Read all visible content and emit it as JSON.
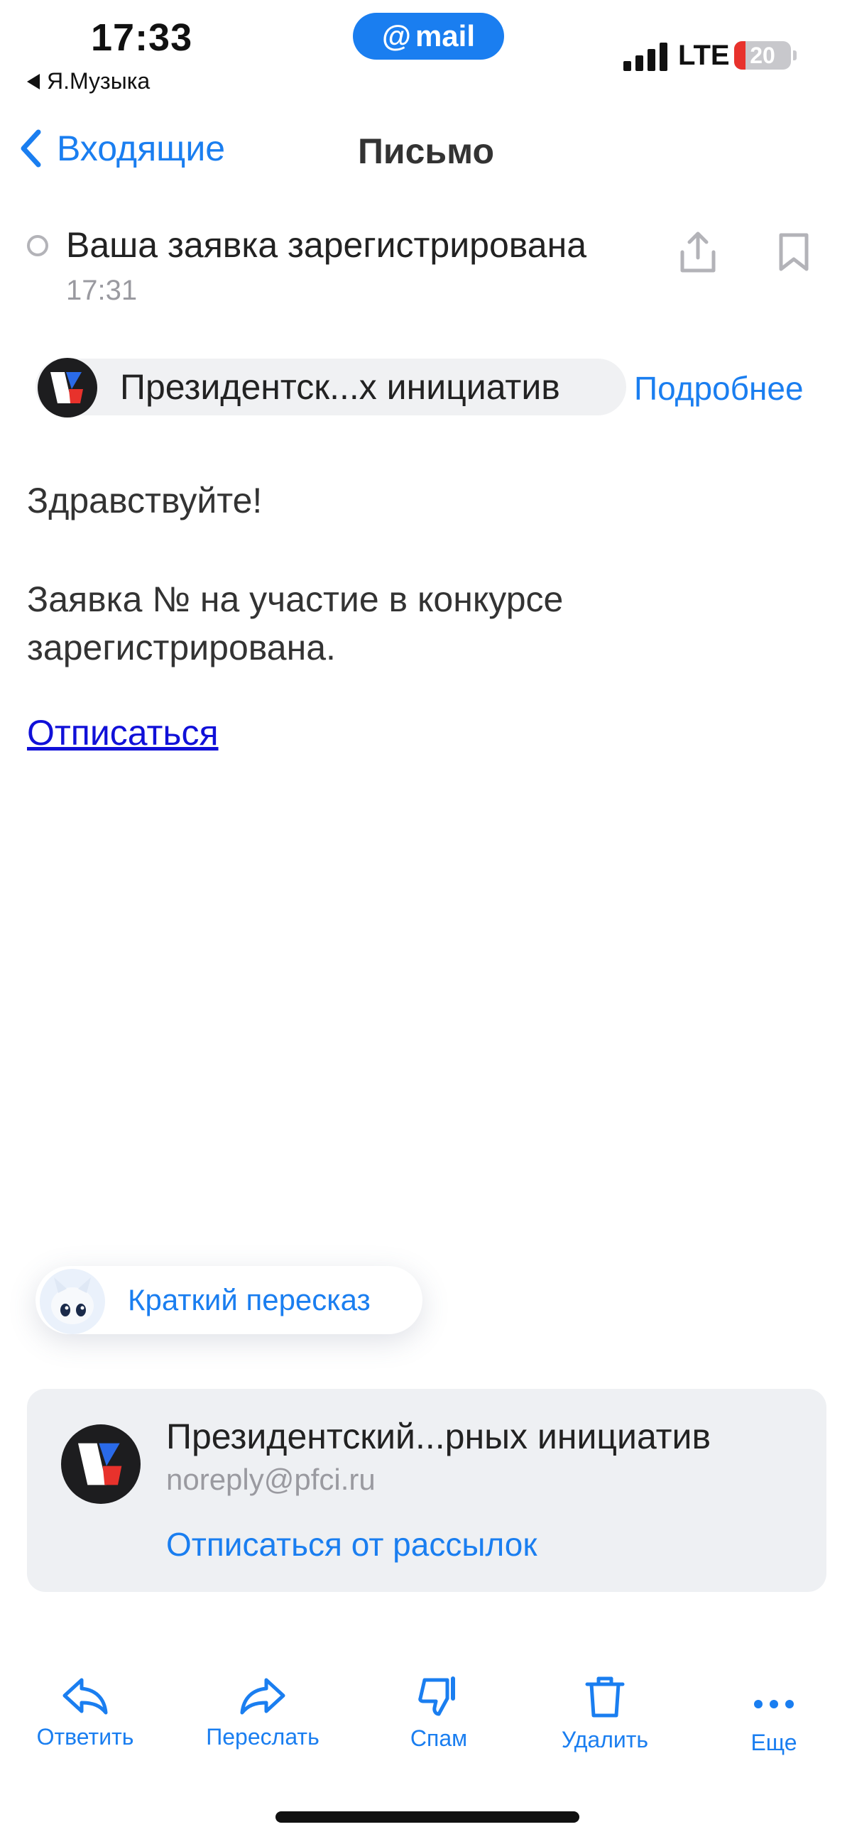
{
  "status_bar": {
    "time": "17:33",
    "back_app": "Я.Музыка",
    "app_badge_at": "@",
    "app_badge": "mail",
    "network": "LTE",
    "battery": "20",
    "battery_level": 0.2
  },
  "nav": {
    "back_label": "Входящие",
    "title": "Письмо"
  },
  "message": {
    "subject": "Ваша заявка зарегистрирована",
    "time": "17:31",
    "sender_short": "Президентск...х инициатив",
    "details_link": "Подробнее",
    "greeting": "Здравствуйте!",
    "body": "Заявка № на участие в конкурсе зарегистрирована.",
    "unsubscribe_link": "Отписаться"
  },
  "summary": {
    "label": "Краткий пересказ"
  },
  "sender_card": {
    "name": "Президентский...рных инициатив",
    "email": "noreply@pfci.ru",
    "unsubscribe": "Отписаться от рассылок"
  },
  "toolbar": {
    "reply": "Ответить",
    "forward": "Переслать",
    "spam": "Спам",
    "delete": "Удалить",
    "more": "Еще"
  },
  "colors": {
    "accent": "#1a7ef0",
    "link": "#1010d8",
    "battery_low": "#e8322c"
  }
}
